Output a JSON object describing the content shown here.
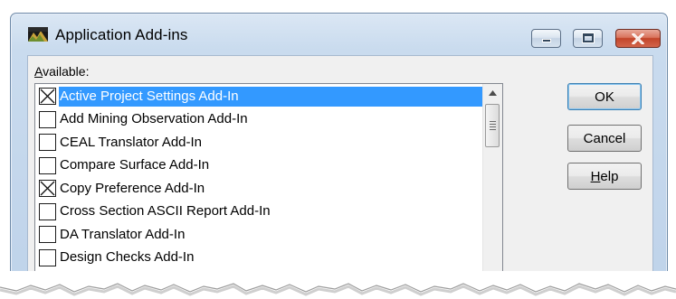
{
  "window": {
    "title": "Application Add-ins",
    "controls": {
      "minimize": "minimize",
      "maximize": "maximize",
      "close": "close"
    }
  },
  "available": {
    "label_underlined": "A",
    "label_rest": "vailable:",
    "items": [
      {
        "label": "Active Project Settings Add-In",
        "checked": true,
        "selected": true
      },
      {
        "label": "Add Mining Observation Add-In",
        "checked": false,
        "selected": false
      },
      {
        "label": "CEAL Translator Add-In",
        "checked": false,
        "selected": false
      },
      {
        "label": "Compare Surface Add-In",
        "checked": false,
        "selected": false
      },
      {
        "label": "Copy Preference Add-In",
        "checked": true,
        "selected": false
      },
      {
        "label": "Cross Section ASCII Report Add-In",
        "checked": false,
        "selected": false
      },
      {
        "label": "DA Translator Add-In",
        "checked": false,
        "selected": false
      },
      {
        "label": "Design Checks Add-In",
        "checked": false,
        "selected": false
      }
    ]
  },
  "buttons": {
    "ok": "OK",
    "cancel": "Cancel",
    "help_underlined": "H",
    "help_rest": "elp"
  },
  "colors": {
    "selection": "#3399ff",
    "titlebar": "#c9dbee",
    "close_button": "#c2452a"
  }
}
